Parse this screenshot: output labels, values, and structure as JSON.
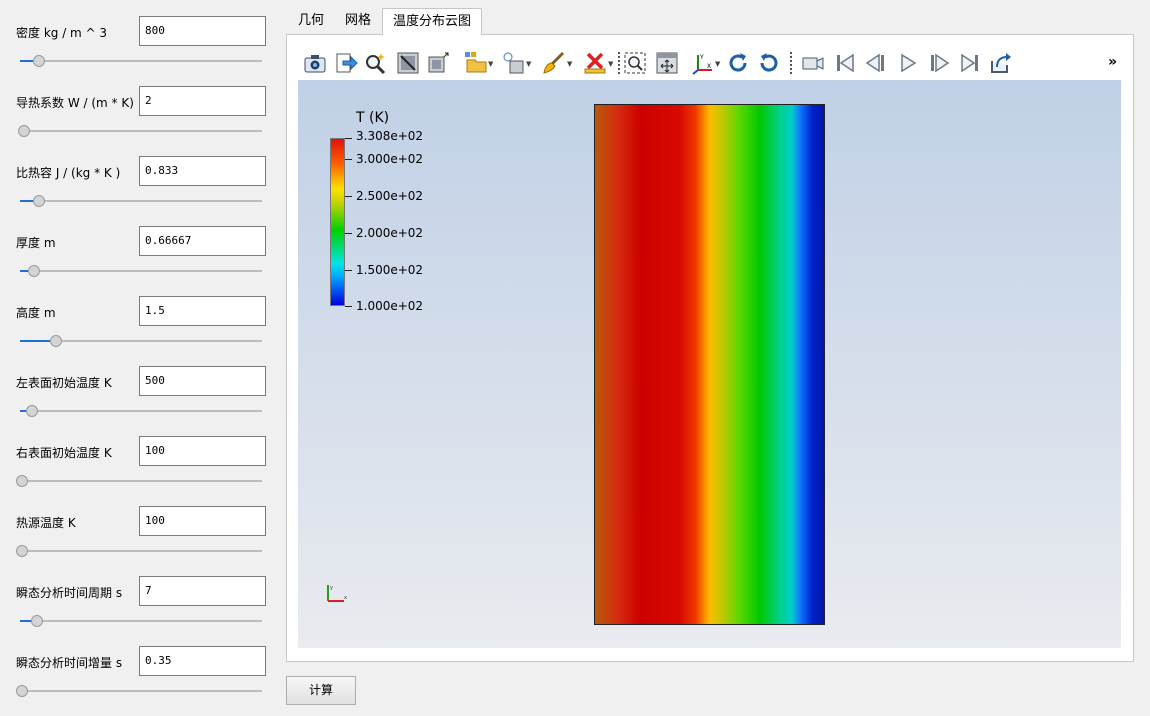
{
  "params": [
    {
      "label": "密度 kg / m ^ 3",
      "value": "800",
      "slider": 0.07
    },
    {
      "label": "导热系数 W / (m * K)",
      "value": "2",
      "slider": 0.01
    },
    {
      "label": "比热容 J / (kg * K )",
      "value": "0.833",
      "slider": 0.07
    },
    {
      "label": "厚度 m",
      "value": "0.66667",
      "slider": 0.05
    },
    {
      "label": "高度 m",
      "value": "1.5",
      "slider": 0.14
    },
    {
      "label": "左表面初始温度 K",
      "value": "500",
      "slider": 0.04
    },
    {
      "label": "右表面初始温度 K",
      "value": "100",
      "slider": 0.0
    },
    {
      "label": "热源温度  K",
      "value": "100",
      "slider": 0.0
    },
    {
      "label": "瞬态分析时间周期 s",
      "value": "7",
      "slider": 0.06
    },
    {
      "label": "瞬态分析时间增量 s",
      "value": "0.35",
      "slider": 0.0
    }
  ],
  "tabs": [
    {
      "label": "几何",
      "active": false
    },
    {
      "label": "网格",
      "active": false
    },
    {
      "label": "温度分布云图",
      "active": true
    }
  ],
  "toolbar": {
    "icons": [
      "camera-icon",
      "export-icon",
      "magic-zoom-icon",
      "reset-view-icon",
      "select-box-icon",
      "open-file-icon",
      "light-bulb-icon",
      "brush-icon",
      "delete-icon",
      "zoom-to-box-icon",
      "fit-all-icon",
      "axes-icon",
      "rotate-cw-icon",
      "rotate-ccw-icon",
      "video-camera-icon",
      "first-frame-icon",
      "previous-frame-icon",
      "play-icon",
      "next-frame-icon",
      "last-frame-icon",
      "loop-icon"
    ],
    "more": "»"
  },
  "legend": {
    "title": "T (K)",
    "labels": [
      "3.308e+02",
      "3.000e+02",
      "2.500e+02",
      "2.000e+02",
      "1.500e+02",
      "1.000e+02"
    ],
    "range": [
      100.0,
      330.8
    ],
    "colors": [
      "#0000e0",
      "#00e5e5",
      "#00d000",
      "#ffe000",
      "#ff6000",
      "#e01010"
    ]
  },
  "axes": {
    "x": "x",
    "y": "y"
  },
  "calc_button": "计算"
}
